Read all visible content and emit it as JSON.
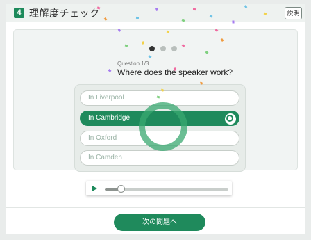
{
  "header": {
    "step_number": "4",
    "title": "理解度チェック",
    "help_label": "説明"
  },
  "quiz": {
    "progress": {
      "total": 3,
      "current": 1
    },
    "question_number": "Question 1/3",
    "question_text": "Where does the speaker work?",
    "choices": [
      {
        "label": "In Liverpool",
        "selected": false
      },
      {
        "label": "In Cambridge",
        "selected": true
      },
      {
        "label": "In Oxford",
        "selected": false
      },
      {
        "label": "In Camden",
        "selected": false
      }
    ]
  },
  "player": {
    "progress_fraction": 0.13
  },
  "footer": {
    "next_label": "次の問題へ"
  },
  "colors": {
    "accent": "#1f8a5c",
    "ring": "#39a870",
    "confetti": [
      "#f06aa0",
      "#f2d24a",
      "#6ec3e6",
      "#a67cf0",
      "#7fd07f",
      "#f09a3e"
    ]
  }
}
